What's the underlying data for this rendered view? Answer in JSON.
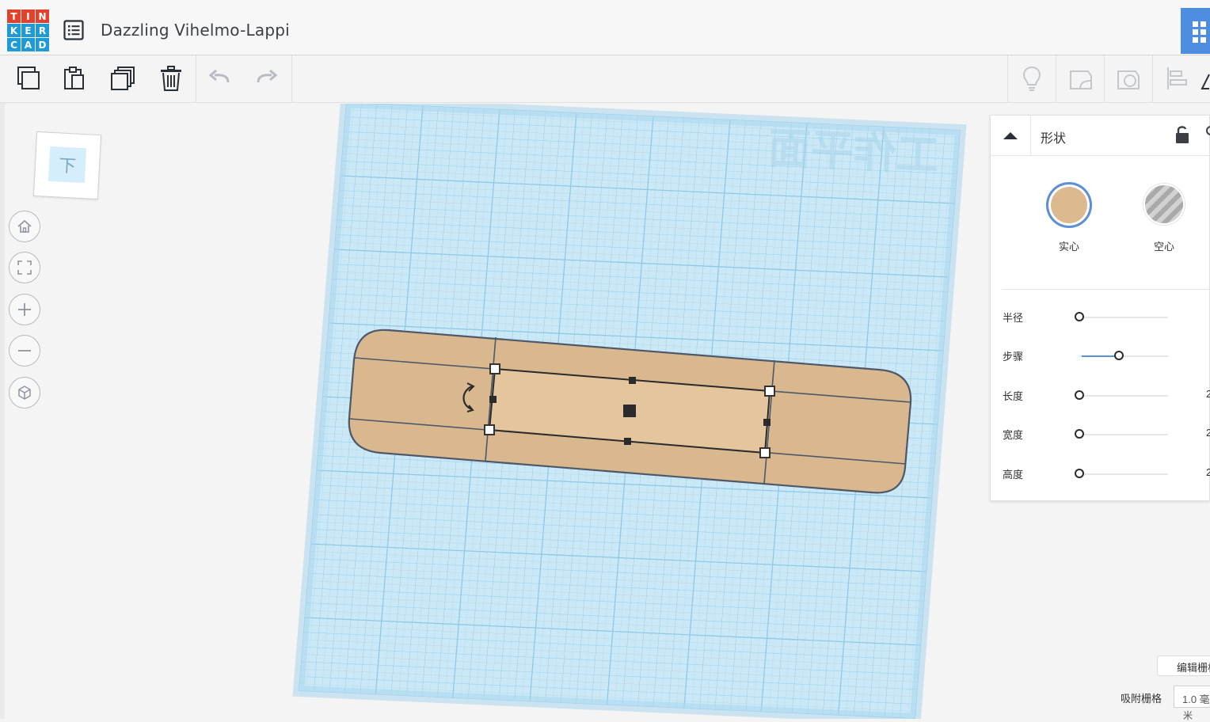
{
  "app": {
    "logo_letters": [
      "T",
      "I",
      "N",
      "K",
      "E",
      "R",
      "C",
      "A",
      "D"
    ],
    "logo_colors": [
      "#e2412c",
      "#e2412c",
      "#e2412c",
      "#1e9bd7",
      "#1e9bd7",
      "#1e9bd7",
      "#1e9bd7",
      "#1e9bd7",
      "#1e9bd7"
    ],
    "document_title": "Dazzling Vihelmo-Lappi"
  },
  "toolbar": {
    "icons": [
      "copy-icon",
      "paste-icon",
      "duplicate-icon",
      "delete-icon",
      "undo-icon",
      "redo-icon",
      "light-bulb-icon",
      "note-icon",
      "comment-icon",
      "align-icon",
      "flip-icon"
    ]
  },
  "viewcube": {
    "face_label": "下"
  },
  "nav": {
    "buttons": [
      "home-view-icon",
      "fit-view-icon",
      "zoom-in-icon",
      "zoom-out-icon",
      "perspective-icon"
    ]
  },
  "workplane": {
    "watermark": "工作平面",
    "color": "#cbe8f7",
    "grid_color": "#8dc7e4"
  },
  "shape": {
    "color": "#dab88f",
    "outline": "#4d5868"
  },
  "inspector": {
    "title": "形状",
    "solid_label": "实心",
    "hole_label": "空心",
    "solid_color": "#ddb98f",
    "accent": "#5b8fd8",
    "properties": [
      {
        "label": "半径",
        "value_fraction": 0.0
      },
      {
        "label": "步骤",
        "value_fraction": 0.45
      },
      {
        "label": "长度",
        "value_fraction": 0.0,
        "clipped_value": "2"
      },
      {
        "label": "宽度",
        "value_fraction": 0.0,
        "clipped_value": "2"
      },
      {
        "label": "高度",
        "value_fraction": 0.0,
        "clipped_value": "2"
      }
    ]
  },
  "grid": {
    "edit_label": "编辑栅格",
    "snap_label": "吸附栅格",
    "snap_value": "1.0 毫",
    "snap_unit": "米"
  }
}
